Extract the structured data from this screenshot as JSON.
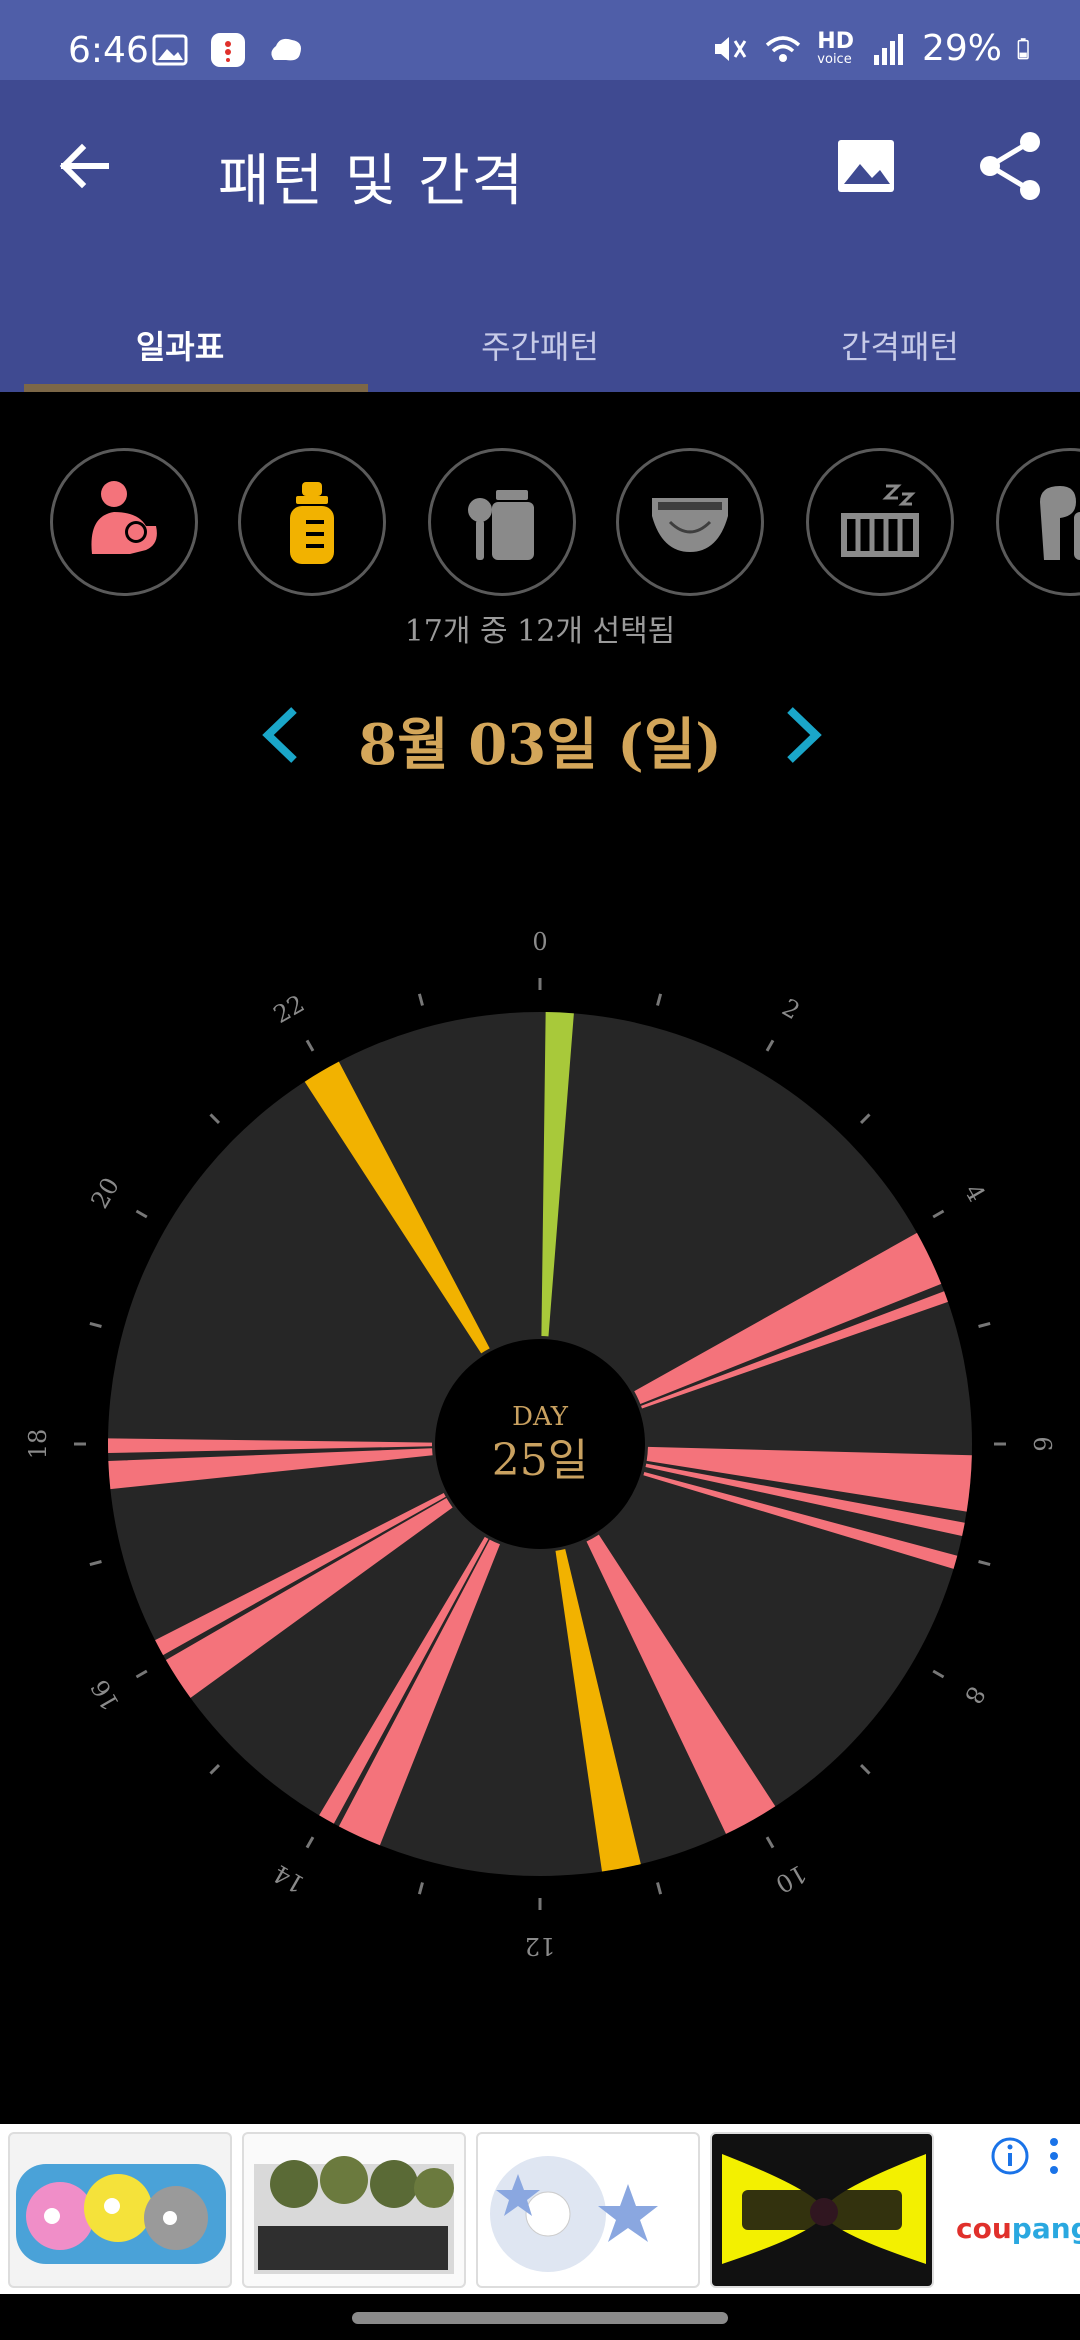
{
  "status_bar": {
    "time": "6:46",
    "battery": "29%",
    "network_label": "HD",
    "network_sub": "voice"
  },
  "header": {
    "title": "패턴 및 간격"
  },
  "tabs": [
    {
      "label": "일과표",
      "active": true
    },
    {
      "label": "주간패턴",
      "active": false
    },
    {
      "label": "간격패턴",
      "active": false
    }
  ],
  "categories": [
    {
      "icon": "breastfeeding-icon",
      "color": "#f4737b"
    },
    {
      "icon": "baby-bottle-icon",
      "color": "#f2b200"
    },
    {
      "icon": "baby-food-icon",
      "color": "#8a8a8a"
    },
    {
      "icon": "diaper-icon",
      "color": "#8a8a8a"
    },
    {
      "icon": "crib-sleep-icon",
      "color": "#8a8a8a"
    },
    {
      "icon": "pump-icon",
      "color": "#8a8a8a"
    }
  ],
  "selected_count": "17개 중 12개 선택됨",
  "date": {
    "label": "8월 03일 (일)"
  },
  "clock": {
    "hour_labels": [
      "0",
      "2",
      "4",
      "6",
      "8",
      "10",
      "12",
      "14",
      "16",
      "18",
      "20",
      "22"
    ],
    "center_top": "DAY",
    "center_main": "25일",
    "events": [
      {
        "type": "baby-food",
        "start": 0.05,
        "end": 0.3,
        "color": "#a8c93a"
      },
      {
        "type": "breastfeeding",
        "start": 4.05,
        "end": 4.55,
        "color": "#f4737b"
      },
      {
        "type": "breastfeeding",
        "start": 4.62,
        "end": 4.72,
        "color": "#f4737b"
      },
      {
        "type": "breastfeeding",
        "start": 6.1,
        "end": 6.6,
        "color": "#f4737b"
      },
      {
        "type": "breastfeeding",
        "start": 6.7,
        "end": 6.82,
        "color": "#f4737b"
      },
      {
        "type": "breastfeeding",
        "start": 7.0,
        "end": 7.12,
        "color": "#f4737b"
      },
      {
        "type": "breastfeeding",
        "start": 9.8,
        "end": 10.3,
        "color": "#f4737b"
      },
      {
        "type": "baby-bottle",
        "start": 11.1,
        "end": 11.45,
        "color": "#f2b200"
      },
      {
        "type": "breastfeeding",
        "start": 13.45,
        "end": 13.85,
        "color": "#f4737b"
      },
      {
        "type": "breastfeeding",
        "start": 13.9,
        "end": 14.05,
        "color": "#f4737b"
      },
      {
        "type": "breastfeeding",
        "start": 15.6,
        "end": 16.0,
        "color": "#f4737b"
      },
      {
        "type": "breastfeeding",
        "start": 16.05,
        "end": 16.2,
        "color": "#f4737b"
      },
      {
        "type": "breastfeeding",
        "start": 17.6,
        "end": 17.85,
        "color": "#f4737b"
      },
      {
        "type": "breastfeeding",
        "start": 17.92,
        "end": 18.05,
        "color": "#f4737b"
      },
      {
        "type": "baby-bottle",
        "start": 21.8,
        "end": 22.15,
        "color": "#f2b200"
      }
    ]
  },
  "ads": {
    "brand_part1": "cou",
    "brand_part2": "pang"
  }
}
